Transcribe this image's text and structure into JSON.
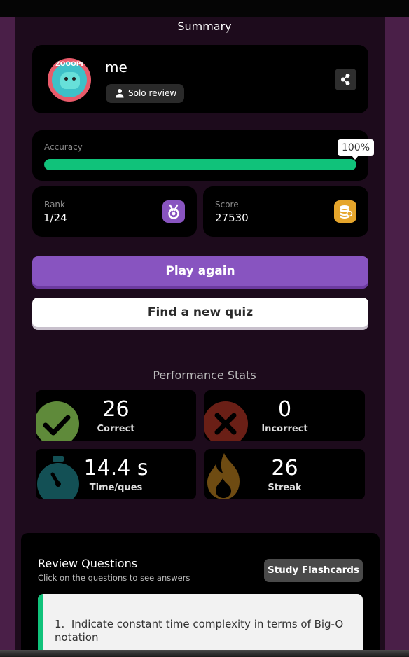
{
  "summary": {
    "title": "Summary"
  },
  "profile": {
    "name": "me",
    "avatar_text": "ZOOOPI",
    "mode_label": "Solo review",
    "share_icon": "share-icon"
  },
  "accuracy": {
    "label": "Accuracy",
    "value_text": "100%",
    "percent": 100,
    "color": "#10c27a"
  },
  "rank": {
    "label": "Rank",
    "value": "1/24",
    "icon": "medal-icon",
    "color": "#8854c0"
  },
  "score": {
    "label": "Score",
    "value": "27530",
    "icon": "coins-icon",
    "color": "#e5a52b"
  },
  "actions": {
    "play_again": "Play again",
    "find_quiz": "Find a new quiz"
  },
  "performance": {
    "title": "Performance Stats",
    "correct": {
      "value": "26",
      "label": "Correct",
      "icon": "check-icon"
    },
    "incorrect": {
      "value": "0",
      "label": "Incorrect",
      "icon": "cross-icon"
    },
    "time": {
      "value": "14.4 s",
      "label": "Time/ques",
      "icon": "stopwatch-icon"
    },
    "streak": {
      "value": "26",
      "label": "Streak",
      "icon": "flame-icon"
    }
  },
  "review": {
    "title": "Review Questions",
    "subtitle": "Click on the questions to see answers",
    "flashcards_button": "Study Flashcards",
    "questions": [
      {
        "number": "1.",
        "text": "Indicate constant time complexity in terms of Big-O notation"
      }
    ]
  }
}
